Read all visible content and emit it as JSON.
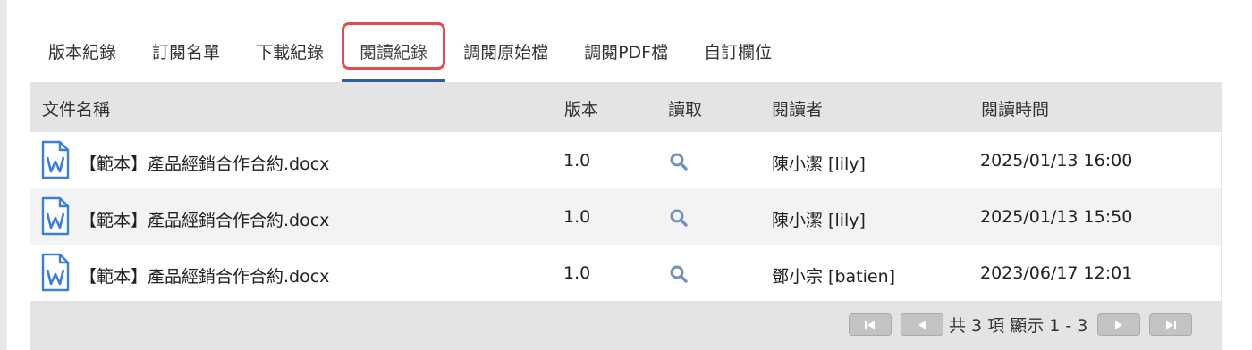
{
  "tabs": [
    {
      "label": "版本紀錄"
    },
    {
      "label": "訂閱名單"
    },
    {
      "label": "下載紀錄"
    },
    {
      "label": "閱讀紀錄"
    },
    {
      "label": "調閱原始檔"
    },
    {
      "label": "調閱PDF檔"
    },
    {
      "label": "自訂欄位"
    }
  ],
  "active_tab": "閱讀紀錄",
  "table": {
    "columns": [
      "文件名稱",
      "版本",
      "讀取",
      "閱讀者",
      "閱讀時間"
    ],
    "rows": [
      {
        "file_icon": "word-doc-icon",
        "name": "【範本】產品經銷合作合約.docx",
        "version": "1.0",
        "read_icon": "search-icon",
        "reader": "陳小潔 [lily]",
        "time": "2025/01/13 16:00"
      },
      {
        "file_icon": "word-doc-icon",
        "name": "【範本】產品經銷合作合約.docx",
        "version": "1.0",
        "read_icon": "search-icon",
        "reader": "陳小潔 [lily]",
        "time": "2025/01/13 15:50"
      },
      {
        "file_icon": "word-doc-icon",
        "name": "【範本】產品經銷合作合約.docx",
        "version": "1.0",
        "read_icon": "search-icon",
        "reader": "鄧小宗 [batien]",
        "time": "2023/06/17 12:01"
      }
    ]
  },
  "pager": {
    "first_icon": "first-page-icon",
    "prev_icon": "prev-page-icon",
    "summary": "共 3 項 顯示 1 - 3",
    "next_icon": "next-page-icon",
    "last_icon": "last-page-icon"
  },
  "colors": {
    "active_tab_underline": "#2f5ea8",
    "highlight_border": "#e44b4f",
    "icon_blue": "#3b7fd6",
    "search_icon": "#6f92bf"
  }
}
